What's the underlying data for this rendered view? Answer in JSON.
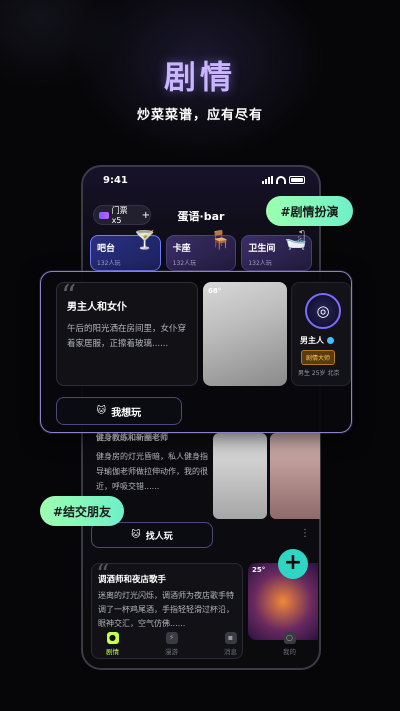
{
  "hero": {
    "title": "剧情",
    "subtitle": "炒菜菜谱，应有尽有"
  },
  "status_bar": {
    "time": "9:41"
  },
  "header": {
    "ticket_label": "门票x5",
    "ticket_plus": "+",
    "app_title": "蛋语·bar"
  },
  "rooms": [
    {
      "name": "吧台",
      "count": "132人玩",
      "icon": "🍸"
    },
    {
      "name": "卡座",
      "count": "132人玩",
      "icon": "🪑"
    },
    {
      "name": "卫生间",
      "count": "132人玩",
      "icon": "🛁"
    }
  ],
  "tags": {
    "roleplay": "#剧情扮演",
    "friends": "#结交朋友"
  },
  "popup": {
    "quote_mark": "“",
    "title": "男主人和女仆",
    "body": "午后的阳光洒在房间里，女仆穿着家居服，正擦着玻璃......",
    "temperature": "68°",
    "profile": {
      "name": "男主人",
      "role_tag": "剧情大师",
      "meta": "男生 25岁 北京"
    },
    "action_label": "我想玩"
  },
  "card2": {
    "title": "健身教练和新圈老师",
    "body": "健身房的灯光昏暗，私人健身指导瑜伽老师做拉伸动作，我的很近，呼吸交错......",
    "action_label": "找人玩",
    "more": "⋮"
  },
  "card3": {
    "quote_mark": "“",
    "title": "调酒师和夜店歌手",
    "body": "迷离的灯光闪烁，调酒师为夜店歌手特调了一杯鸡尾酒，手指轻轻滑过杯沿，眼神交汇，空气仿佛......",
    "temperature": "25°"
  },
  "fab_label": "+",
  "tabbar": [
    {
      "label": "剧情",
      "active": true,
      "icon": "cat-icon"
    },
    {
      "label": "漫游",
      "active": false,
      "icon": "lightning-icon"
    },
    {
      "label": "消息",
      "active": false,
      "icon": "message-icon"
    },
    {
      "label": "我的",
      "active": false,
      "icon": "profile-icon"
    }
  ],
  "colors": {
    "accent_green": "#9cffb0",
    "tab_active": "#c7ff4a",
    "fab": "#2fd6c4",
    "popup_border": "#8a82c8"
  }
}
